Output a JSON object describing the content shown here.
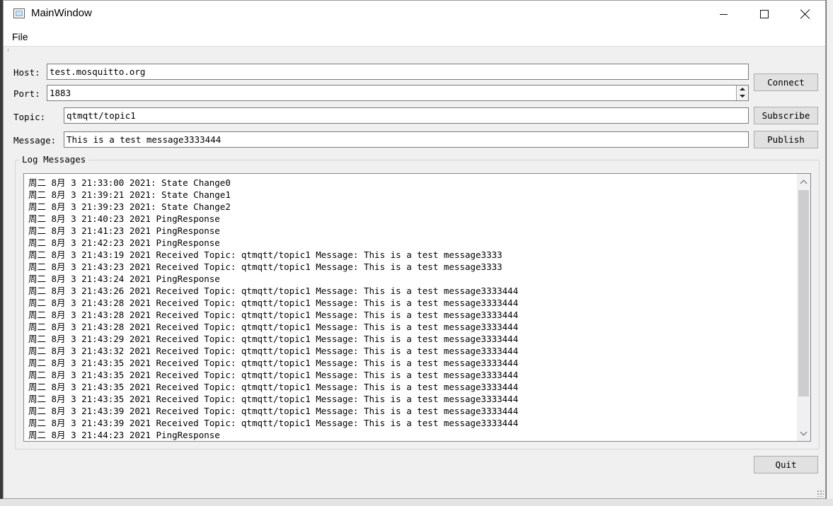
{
  "window": {
    "title": "MainWindow"
  },
  "menu": {
    "file": "File"
  },
  "form": {
    "host_label": "Host:",
    "host_value": "test.mosquitto.org",
    "port_label": "Port:",
    "port_value": "1883",
    "topic_label": "Topic:",
    "topic_value": "qtmqtt/topic1",
    "message_label": "Message:",
    "message_value": "This is a test message3333444"
  },
  "buttons": {
    "connect": "Connect",
    "subscribe": "Subscribe",
    "publish": "Publish",
    "quit": "Quit"
  },
  "log": {
    "title": "Log Messages",
    "lines": [
      "周二 8月 3 21:33:00 2021: State Change0",
      "周二 8月 3 21:39:21 2021: State Change1",
      "周二 8月 3 21:39:23 2021: State Change2",
      "周二 8月 3 21:40:23 2021 PingResponse",
      "周二 8月 3 21:41:23 2021 PingResponse",
      "周二 8月 3 21:42:23 2021 PingResponse",
      "周二 8月 3 21:43:19 2021 Received Topic: qtmqtt/topic1 Message: This is a test message3333",
      "周二 8月 3 21:43:23 2021 Received Topic: qtmqtt/topic1 Message: This is a test message3333",
      "周二 8月 3 21:43:24 2021 PingResponse",
      "周二 8月 3 21:43:26 2021 Received Topic: qtmqtt/topic1 Message: This is a test message3333444",
      "周二 8月 3 21:43:28 2021 Received Topic: qtmqtt/topic1 Message: This is a test message3333444",
      "周二 8月 3 21:43:28 2021 Received Topic: qtmqtt/topic1 Message: This is a test message3333444",
      "周二 8月 3 21:43:28 2021 Received Topic: qtmqtt/topic1 Message: This is a test message3333444",
      "周二 8月 3 21:43:29 2021 Received Topic: qtmqtt/topic1 Message: This is a test message3333444",
      "周二 8月 3 21:43:32 2021 Received Topic: qtmqtt/topic1 Message: This is a test message3333444",
      "周二 8月 3 21:43:35 2021 Received Topic: qtmqtt/topic1 Message: This is a test message3333444",
      "周二 8月 3 21:43:35 2021 Received Topic: qtmqtt/topic1 Message: This is a test message3333444",
      "周二 8月 3 21:43:35 2021 Received Topic: qtmqtt/topic1 Message: This is a test message3333444",
      "周二 8月 3 21:43:35 2021 Received Topic: qtmqtt/topic1 Message: This is a test message3333444",
      "周二 8月 3 21:43:39 2021 Received Topic: qtmqtt/topic1 Message: This is a test message3333444",
      "周二 8月 3 21:43:39 2021 Received Topic: qtmqtt/topic1 Message: This is a test message3333444",
      "周二 8月 3 21:44:23 2021 PingResponse"
    ]
  },
  "icons": {
    "app": "app-window-icon",
    "minimize": "minimize-icon",
    "maximize": "maximize-icon",
    "close": "close-icon",
    "spin_up": "chevron-up-icon",
    "spin_down": "chevron-down-icon",
    "scroll_up": "chevron-up-icon",
    "scroll_down": "chevron-down-icon"
  }
}
